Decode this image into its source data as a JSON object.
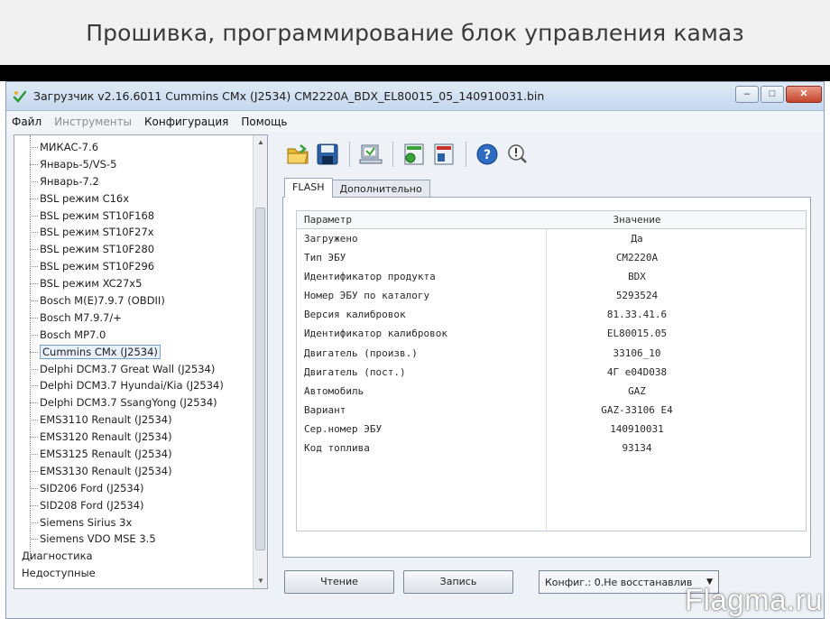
{
  "page_header": {
    "title": "Прошивка, программирование блок управления камаз"
  },
  "window": {
    "title": "Загрузчик v2.16.6011 Cummins CMx (J2534) CM2220A_BDX_EL80015_05_140910031.bin",
    "buttons": {
      "minimize": "‒",
      "maximize": "□",
      "close": "✕"
    }
  },
  "menu": {
    "items": [
      {
        "label": "Файл",
        "enabled": true
      },
      {
        "label": "Инструменты",
        "enabled": false
      },
      {
        "label": "Конфигурация",
        "enabled": true
      },
      {
        "label": "Помощь",
        "enabled": true
      }
    ]
  },
  "tree": {
    "items": [
      {
        "label": "МИКАС-7.6",
        "level": "child"
      },
      {
        "label": "Январь-5/VS-5",
        "level": "child"
      },
      {
        "label": "Январь-7.2",
        "level": "child"
      },
      {
        "label": "BSL режим C16x",
        "level": "child"
      },
      {
        "label": "BSL режим ST10F168",
        "level": "child"
      },
      {
        "label": "BSL режим ST10F27x",
        "level": "child"
      },
      {
        "label": "BSL режим ST10F280",
        "level": "child"
      },
      {
        "label": "BSL режим ST10F296",
        "level": "child"
      },
      {
        "label": "BSL режим XC27x5",
        "level": "child"
      },
      {
        "label": "Bosch M(E)7.9.7 (OBDII)",
        "level": "child"
      },
      {
        "label": "Bosch M7.9.7/+",
        "level": "child"
      },
      {
        "label": "Bosch MP7.0",
        "level": "child"
      },
      {
        "label": "Cummins CMx (J2534)",
        "level": "child",
        "selected": true
      },
      {
        "label": "Delphi DCM3.7 Great Wall (J2534)",
        "level": "child"
      },
      {
        "label": "Delphi DCM3.7 Hyundai/Kia (J2534)",
        "level": "child"
      },
      {
        "label": "Delphi DCM3.7 SsangYong (J2534)",
        "level": "child"
      },
      {
        "label": "EMS3110 Renault (J2534)",
        "level": "child"
      },
      {
        "label": "EMS3120 Renault (J2534)",
        "level": "child"
      },
      {
        "label": "EMS3125 Renault (J2534)",
        "level": "child"
      },
      {
        "label": "EMS3130 Renault (J2534)",
        "level": "child"
      },
      {
        "label": "SID206 Ford (J2534)",
        "level": "child"
      },
      {
        "label": "SID208 Ford (J2534)",
        "level": "child"
      },
      {
        "label": "Siemens Sirius 3x",
        "level": "child"
      },
      {
        "label": "Siemens VDO MSE 3.5",
        "level": "child"
      },
      {
        "label": "Диагностика",
        "level": "root"
      },
      {
        "label": "Недоступные",
        "level": "root"
      }
    ],
    "scroll": {
      "up": "▲",
      "down": "▼"
    }
  },
  "toolbar": {
    "buttons": [
      {
        "name": "open-folder-icon"
      },
      {
        "name": "save-icon"
      },
      {
        "name": "read-ecu-icon"
      },
      {
        "name": "write-green-icon"
      },
      {
        "name": "write-red-icon"
      },
      {
        "name": "help-icon"
      },
      {
        "name": "info-icon"
      }
    ],
    "colors": {
      "folder": "#e7b92e",
      "save": "#2b5fa6",
      "green": "#3aa33a",
      "red": "#c8302a",
      "help": "#2d6bc4"
    }
  },
  "tabs": [
    {
      "label": "FLASH",
      "active": true
    },
    {
      "label": "Дополнительно",
      "active": false
    }
  ],
  "table": {
    "headers": {
      "param": "Параметр",
      "value": "Значение"
    },
    "rows": [
      {
        "param": "Загружено",
        "value": "Да"
      },
      {
        "param": "Тип ЭБУ",
        "value": "CM2220A"
      },
      {
        "param": "Идентификатор продукта",
        "value": "BDX"
      },
      {
        "param": "Номер ЭБУ по каталогу",
        "value": "5293524"
      },
      {
        "param": "Версия калибровок",
        "value": "81.33.41.6"
      },
      {
        "param": "Идентификатор калибровок",
        "value": "EL80015.05"
      },
      {
        "param": "Двигатель (произв.)",
        "value": "33106_10"
      },
      {
        "param": "Двигатель (пост.)",
        "value": "4Г e04D038"
      },
      {
        "param": "Автомобиль",
        "value": "GAZ"
      },
      {
        "param": "Вариант",
        "value": "GAZ-33106 E4"
      },
      {
        "param": "Сер.номер ЭБУ",
        "value": "140910031"
      },
      {
        "param": "Код топлива",
        "value": "93134"
      }
    ]
  },
  "bottom": {
    "read_label": "Чтение",
    "write_label": "Запись",
    "config_select": "Конфиг.: 0.Не восстанавлив",
    "config_arrow": "▼"
  },
  "watermark": {
    "text": "Flagma.ru"
  }
}
